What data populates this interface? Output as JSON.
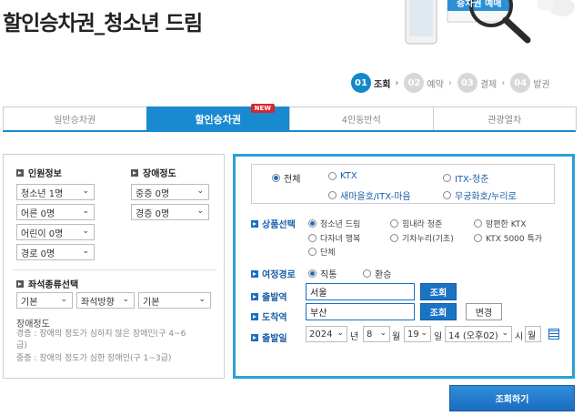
{
  "header": {
    "title": "할인승차권_청소년 드림",
    "device_label": "승차권 예매"
  },
  "steps": [
    {
      "num": "01",
      "label": "조회",
      "arrow": "›",
      "active": true
    },
    {
      "num": "02",
      "label": "예약",
      "arrow": "›",
      "active": false
    },
    {
      "num": "03",
      "label": "결제",
      "arrow": "›",
      "active": false
    },
    {
      "num": "04",
      "label": "발권",
      "arrow": "",
      "active": false
    }
  ],
  "tabs": [
    {
      "label": "일반승차권",
      "active": false
    },
    {
      "label": "할인승차권",
      "active": true,
      "badge": "NEW"
    },
    {
      "label": "4인동반석",
      "active": false
    },
    {
      "label": "관광열차",
      "active": false
    }
  ],
  "left": {
    "passenger_title": "인원정보",
    "disability_title": "장애정도",
    "passengers": [
      "청소년 1명",
      "어른 0명",
      "어린이 0명",
      "경로 0명"
    ],
    "disability": [
      "중증 0명",
      "경증 0명"
    ],
    "seat_title": "좌석종류선택",
    "seat_options": [
      "기본",
      "좌석방향",
      "기본"
    ],
    "note_title": "장애정도",
    "note_lines": [
      "경증 : 장애의 정도가 심하지 않은 장애인(구 4~6",
      "급)",
      "중증 : 장애의 정도가 심한 장애인(구 1~3급)"
    ]
  },
  "right": {
    "train_types": [
      {
        "label": "전체",
        "checked": true
      },
      {
        "label": "KTX",
        "checked": false
      },
      {
        "label": "ITX-청춘",
        "checked": false
      },
      {
        "label": "새마을호/ITX-마음",
        "checked": false
      },
      {
        "label": "무궁화호/누리로",
        "checked": false
      }
    ],
    "product_label": "상품선택",
    "products": [
      {
        "label": "청소년 드림",
        "checked": true
      },
      {
        "label": "힘내라 청춘",
        "checked": false
      },
      {
        "label": "맘편한 KTX",
        "checked": false
      },
      {
        "label": "다자녀 행복",
        "checked": false
      },
      {
        "label": "기차누리(기초)",
        "checked": false
      },
      {
        "label": "KTX 5000 특가",
        "checked": false
      },
      {
        "label": "단체",
        "checked": false
      }
    ],
    "route_label": "여정경로",
    "route_options": [
      {
        "label": "직통",
        "checked": true
      },
      {
        "label": "환승",
        "checked": false
      }
    ],
    "departure_label": "출발역",
    "departure_value": "서울",
    "arrival_label": "도착역",
    "arrival_value": "부산",
    "search_btn": "조회",
    "change_btn": "변경",
    "date_label": "출발일",
    "year": "2024",
    "year_unit": "년",
    "month": "8",
    "month_unit": "월",
    "day": "19",
    "day_unit": "일",
    "hour": "14 (오후02)",
    "hour_unit": "시",
    "weekday": "월"
  },
  "submit_label": "조회하기"
}
